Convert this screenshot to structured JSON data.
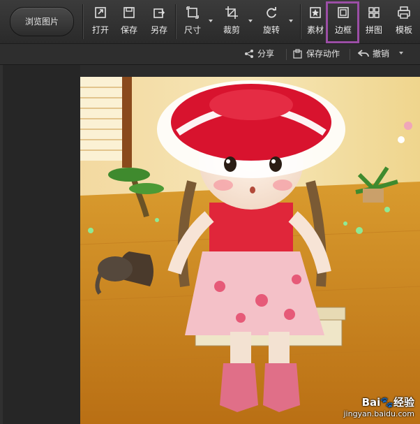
{
  "toolbar": {
    "browse_label": "浏览图片",
    "tools": [
      {
        "label": "打开",
        "icon": "open-icon"
      },
      {
        "label": "保存",
        "icon": "save-icon"
      },
      {
        "label": "另存",
        "icon": "save-as-icon"
      },
      {
        "label": "尺寸",
        "icon": "resize-icon"
      },
      {
        "label": "裁剪",
        "icon": "crop-icon"
      },
      {
        "label": "旋转",
        "icon": "rotate-icon"
      },
      {
        "label": "素材",
        "icon": "material-icon"
      },
      {
        "label": "边框",
        "icon": "frame-icon"
      },
      {
        "label": "拼图",
        "icon": "collage-icon"
      },
      {
        "label": "模板",
        "icon": "template-icon"
      }
    ],
    "highlight_color": "#9b4ea5"
  },
  "subbar": {
    "share": "分享",
    "save_action": "保存动作",
    "undo": "撤销"
  },
  "canvas": {
    "watermark_line1": "Bai",
    "watermark_paw": "🐾",
    "watermark_brand": "经验",
    "watermark_line2": "jingyan.baidu.com"
  }
}
